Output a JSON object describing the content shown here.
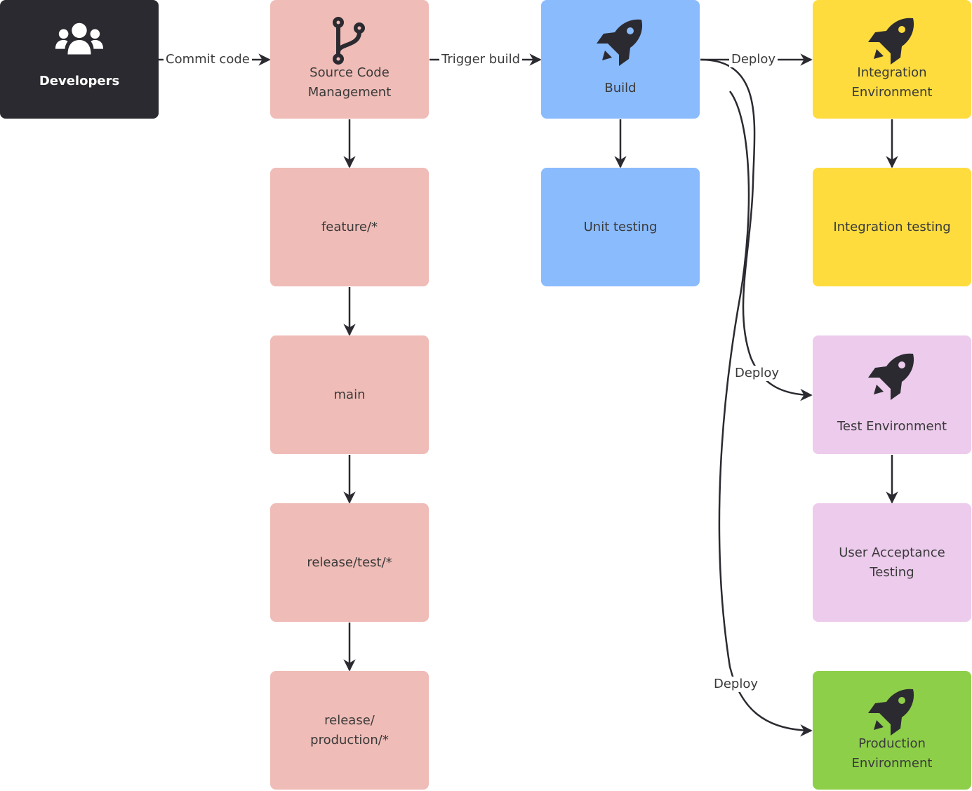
{
  "colors": {
    "developers": "#2b2a30",
    "scm": "#efbcb7",
    "build": "#8abbfd",
    "integration": "#fedc3e",
    "test": "#eccbec",
    "production": "#8ecf4a",
    "connector": "#2b2a30",
    "text": "#3a3a3a"
  },
  "nodes": {
    "developers": {
      "label": "Developers",
      "icon": "users-icon"
    },
    "scm": {
      "label": "Source Code\nManagement",
      "icon": "git-branch-icon"
    },
    "feature": {
      "label": "feature/*"
    },
    "main": {
      "label": "main"
    },
    "release_test": {
      "label": "release/test/*"
    },
    "release_production": {
      "label": "release/\nproduction/*"
    },
    "build": {
      "label": "Build",
      "icon": "rocket-icon"
    },
    "unit_testing": {
      "label": "Unit testing"
    },
    "integration_env": {
      "label": "Integration\nEnvironment",
      "icon": "rocket-icon"
    },
    "integration_testing": {
      "label": "Integration testing"
    },
    "test_env": {
      "label": "Test Environment",
      "icon": "rocket-icon"
    },
    "uat": {
      "label": "User Acceptance\nTesting"
    },
    "production_env": {
      "label": "Production\nEnvironment",
      "icon": "rocket-icon"
    }
  },
  "edges": {
    "commit": {
      "label": "Commit code",
      "from": "developers",
      "to": "scm"
    },
    "trigger": {
      "label": "Trigger build",
      "from": "scm",
      "to": "build"
    },
    "deploy_integration": {
      "label": "Deploy",
      "from": "build",
      "to": "integration_env"
    },
    "deploy_test": {
      "label": "Deploy",
      "from": "build",
      "to": "test_env"
    },
    "deploy_production": {
      "label": "Deploy",
      "from": "build",
      "to": "production_env"
    }
  }
}
